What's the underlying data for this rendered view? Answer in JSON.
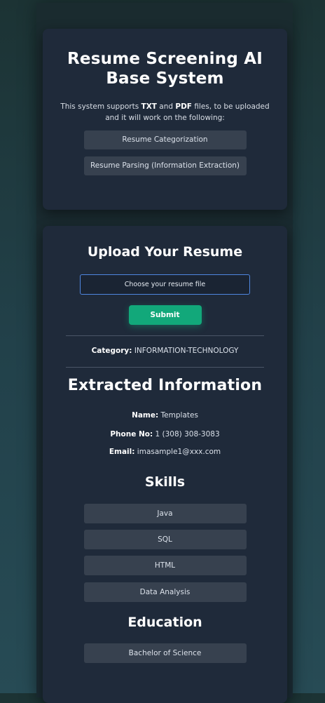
{
  "intro_card": {
    "title": "Resume Screening AI Base System",
    "intro_prefix": "This system supports ",
    "format_txt": "TXT",
    "intro_and": " and ",
    "format_pdf": "PDF",
    "intro_suffix": " files, to be uploaded and it will work on the following:",
    "features": [
      "Resume Categorization",
      "Resume Parsing (Information Extraction)"
    ]
  },
  "upload": {
    "title": "Upload Your Resume",
    "file_input_label": "Choose your resume file",
    "submit_label": "Submit"
  },
  "result": {
    "category_label": "Category:",
    "category_value": "INFORMATION-TECHNOLOGY",
    "extracted_title": "Extracted Information",
    "name_label": "Name:",
    "name_value": "Templates",
    "phone_label": "Phone No:",
    "phone_value": "1 (308) 308-3083",
    "email_label": "Email:",
    "email_value": "imasample1@xxx.com",
    "skills_title": "Skills",
    "skills": [
      "Java",
      "SQL",
      "HTML",
      "Data Analysis"
    ],
    "education_title": "Education",
    "education": [
      "Bachelor of Science"
    ]
  },
  "colors": {
    "card_bg": "#1f2a3a",
    "pill_bg": "#37414f",
    "accent_green": "#12a87a",
    "input_border": "#4f86e0"
  }
}
